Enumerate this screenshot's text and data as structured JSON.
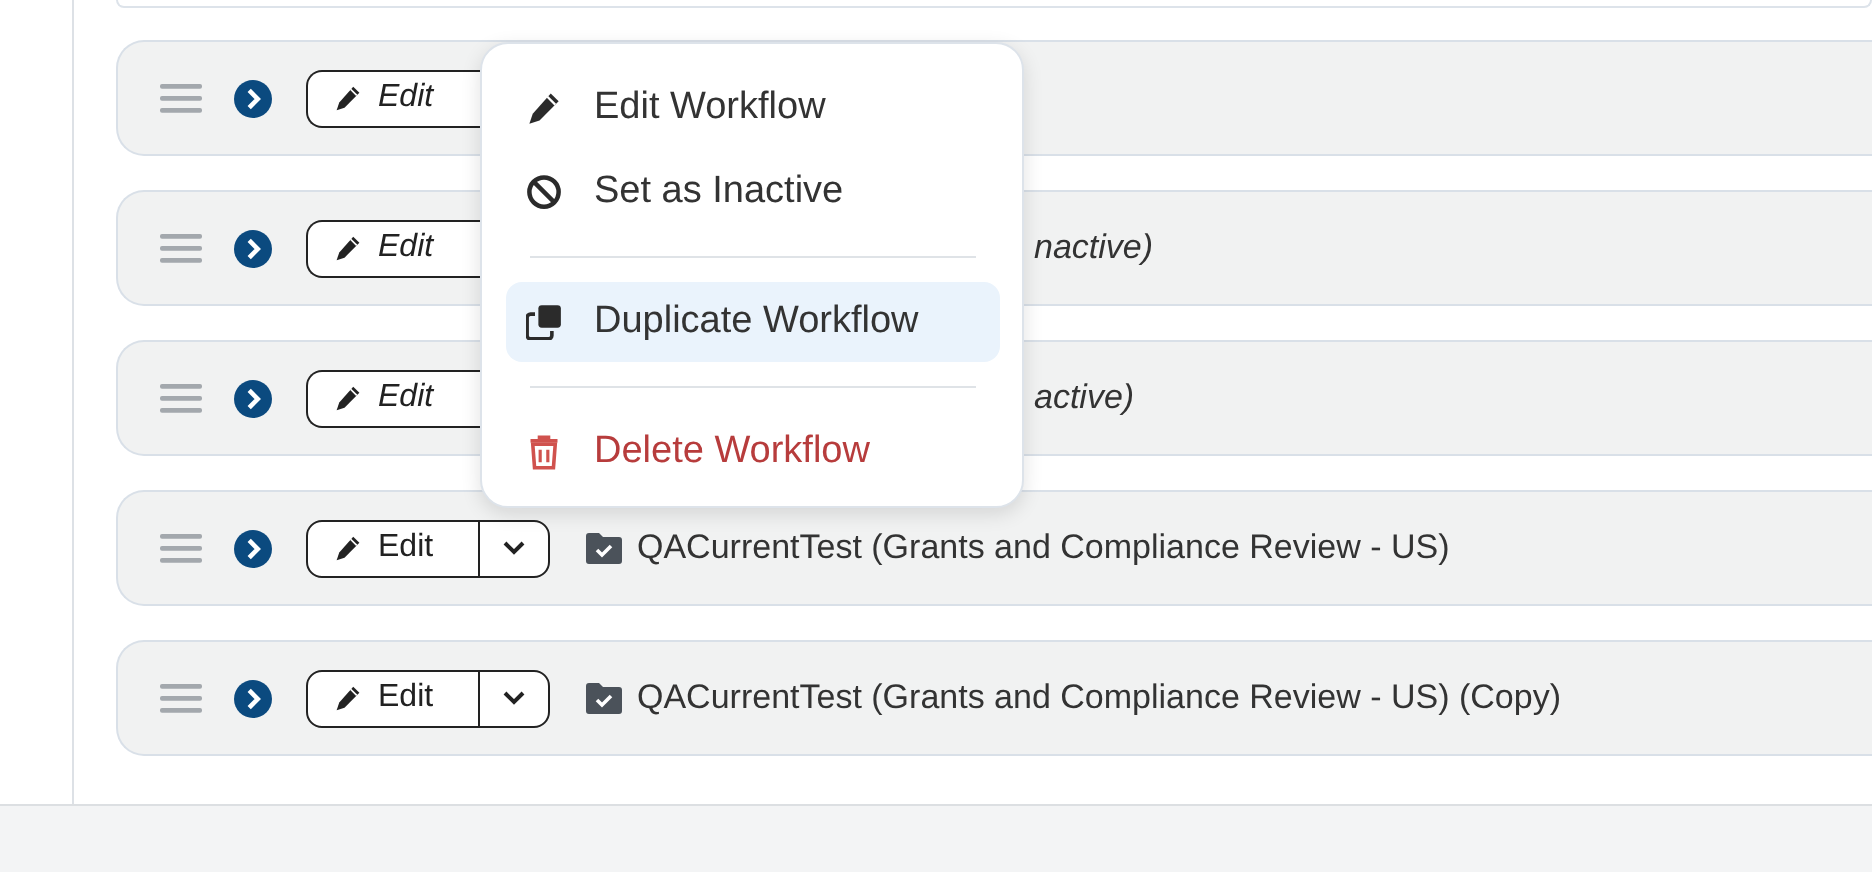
{
  "rows": [
    {
      "covered": true,
      "edit_label": "Edit"
    },
    {
      "covered": true,
      "edit_label": "Edit",
      "title": "nactive)",
      "inactive": true
    },
    {
      "covered": true,
      "edit_label": "Edit",
      "title": "active)",
      "inactive": true
    },
    {
      "covered": false,
      "edit_label": "Edit",
      "title": "QACurrentTest (Grants and Compliance Review - US)",
      "inactive": false
    },
    {
      "covered": false,
      "edit_label": "Edit",
      "title": "QACurrentTest (Grants and Compliance Review - US) (Copy)",
      "inactive": false
    }
  ],
  "menu": {
    "groups": [
      {
        "items": [
          {
            "label": "Edit Workflow",
            "kind": "edit",
            "selected": false
          },
          {
            "label": "Set as Inactive",
            "kind": "inactivate",
            "selected": false
          }
        ]
      },
      {
        "items": [
          {
            "label": "Duplicate Workflow",
            "kind": "duplicate",
            "selected": true
          }
        ]
      },
      {
        "items": [
          {
            "label": "Delete Workflow",
            "kind": "delete",
            "selected": false
          }
        ]
      }
    ]
  }
}
